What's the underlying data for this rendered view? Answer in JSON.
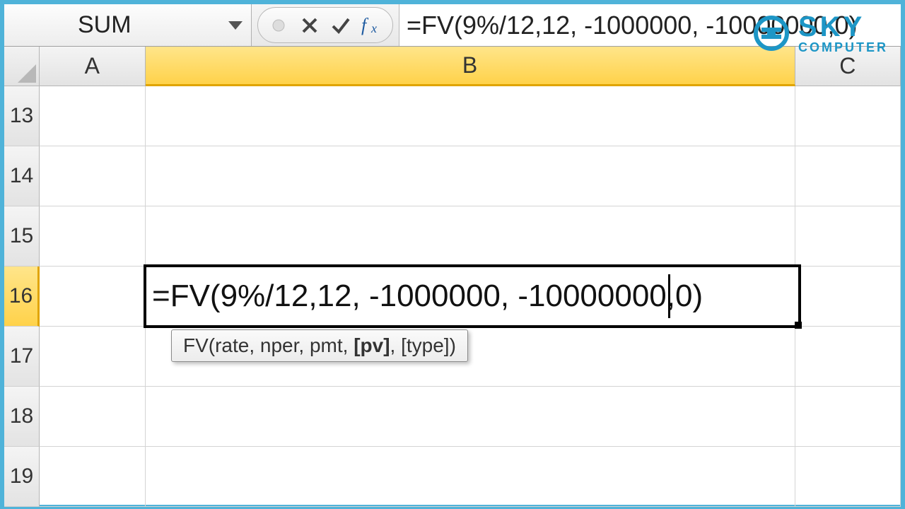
{
  "name_box": "SUM",
  "formula_bar": "=FV(9%/12,12, -1000000, -10000000,0)",
  "columns": [
    "A",
    "B",
    "C"
  ],
  "rows": [
    "13",
    "14",
    "15",
    "16",
    "17",
    "18",
    "19"
  ],
  "active": {
    "row": "16",
    "col": "B",
    "content": "=FV(9%/12,12, -1000000, -10000000,0)"
  },
  "tooltip": {
    "fn": "FV",
    "args_pre": "rate, nper, pmt, ",
    "arg_bold": "[pv]",
    "args_post": ", [type]"
  },
  "logo": {
    "line1": "SKY",
    "line2": "COMPUTER"
  }
}
